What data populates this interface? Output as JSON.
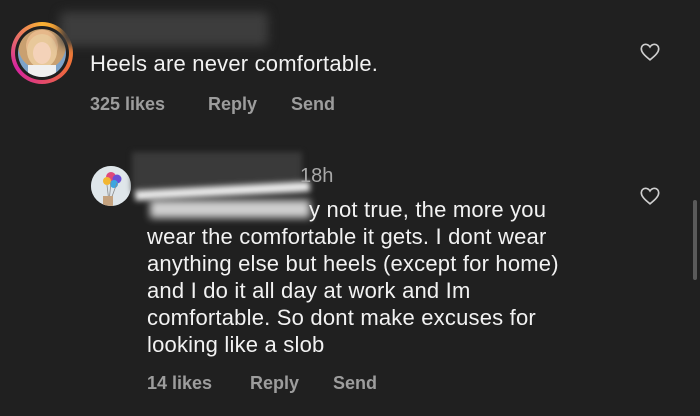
{
  "comments": [
    {
      "text": "Heels are never comfortable.",
      "likes": "325 likes",
      "reply_label": "Reply",
      "send_label": "Send"
    },
    {
      "time": "18h",
      "lines": [
        "y not true, the more you",
        "wear the comfortable it gets. I dont wear",
        "anything else but heels (except for home)",
        "and I do it all day at work and Im",
        "comfortable. So dont make excuses for",
        "looking like a slob"
      ],
      "likes": "14 likes",
      "reply_label": "Reply",
      "send_label": "Send"
    }
  ],
  "colors": {
    "background": "#202020",
    "text": "#f2f2f2",
    "meta": "#9d9d9d"
  }
}
